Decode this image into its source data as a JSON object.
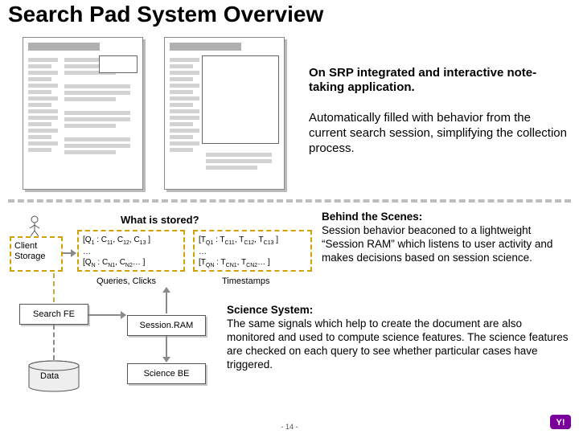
{
  "title": "Search Pad System Overview",
  "desc_main": "On SRP integrated and interactive note-taking application.",
  "desc_sub": "Automatically filled with behavior from the current search session, simplifying the collection process.",
  "stored_header": "What is stored?",
  "client_storage_label": "Client Storage",
  "queries_box": {
    "line1": "[Q₁ : C₁₁, C₁₂, C₁₃ ]",
    "line2": "…",
    "line3": "[Qₙ : Cₙ₁, Cₙ₂… ]"
  },
  "timestamps_box": {
    "line1": "[T_Q1 : T_C11, T_C12, T_C13 ]",
    "line2": "…",
    "line3": "[T_QN : T_CN1, T_CN2… ]"
  },
  "caption_queries": "Queries, Clicks",
  "caption_timestamps": "Timestamps",
  "behind_heading": "Behind the Scenes:",
  "behind_body": "Session behavior beaconed to a lightweight “Session RAM” which listens to user activity and makes decisions based on session science.",
  "science_heading": "Science System:",
  "science_body": "The same signals which help to create the document are also monitored and used to compute science features. The science features are checked on each query to see whether particular cases have triggered.",
  "node_search_fe": "Search FE",
  "node_session_ram": "Session.RAM",
  "node_science_be": "Science BE",
  "node_data": "Data",
  "page_number": "- 14 -",
  "logo_name": "Yahoo!"
}
